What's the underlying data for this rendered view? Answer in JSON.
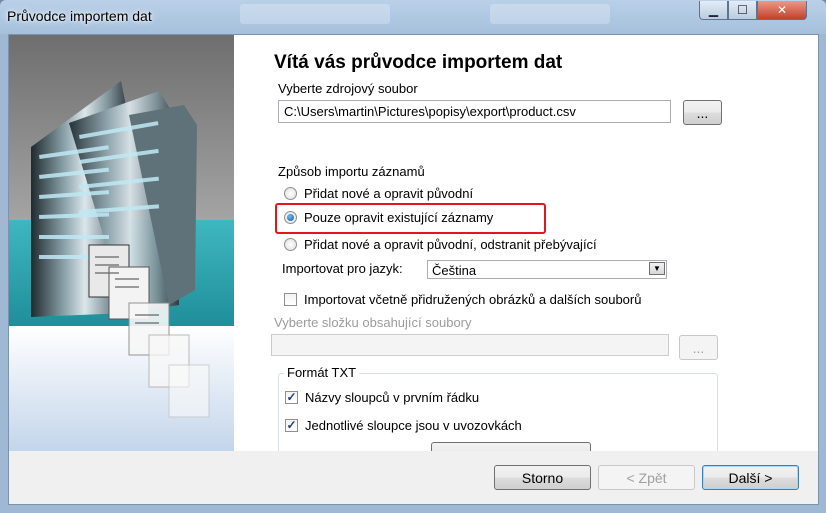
{
  "window": {
    "title": "Průvodce importem dat",
    "min_label": "▁",
    "max_label": "☐",
    "close_label": "✕"
  },
  "wizard": {
    "heading": "Vítá vás průvodce importem dat",
    "source_label": "Vyberte zdrojový soubor",
    "source_path": "C:\\Users\\martin\\Pictures\\popisy\\export\\product.csv",
    "browse_label": "...",
    "mode_label": "Způsob importu záznamů",
    "options": [
      {
        "label": "Přidat nové a opravit původní",
        "checked": false
      },
      {
        "label": "Pouze opravit existující záznamy",
        "checked": true
      },
      {
        "label": "Přidat nové a opravit původní, odstranit přebývající",
        "checked": false
      }
    ],
    "language_label": "Importovat pro jazyk:",
    "language_value": "Čeština",
    "include_files_label": "Importovat včetně přidružených obrázků a dalších souborů",
    "include_files_checked": false,
    "folder_label": "Vyberte  složku obsahující soubory",
    "folder_value": "",
    "folder_browse_label": "...",
    "txt_group_label": "Formát TXT",
    "txt_options": [
      {
        "label": "Názvy sloupců v prvním řádku",
        "checked": true
      },
      {
        "label": "Jednotlivé sloupce jsou v uvozovkách",
        "checked": true
      }
    ]
  },
  "footer": {
    "cancel_label": "Storno",
    "back_label": "< Zpět",
    "next_label": "Další >"
  },
  "colors": {
    "highlight": "#e3161d",
    "side_teal": "#2fa6b0",
    "side_gray": "#8c8c8c",
    "side_light": "#b7cde6"
  }
}
